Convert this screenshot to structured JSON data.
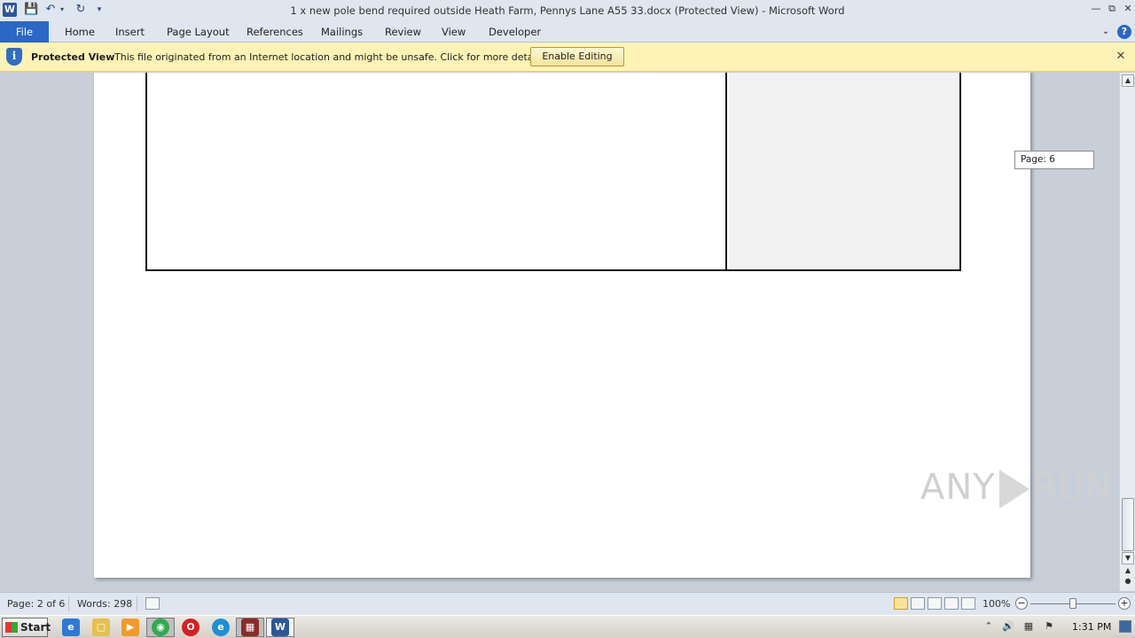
{
  "window": {
    "title": "1 x new pole bend required outside Heath Farm, Pennys Lane A55 33.docx (Protected View)  -  Microsoft Word",
    "app_icon_letter": "W"
  },
  "ribbon": {
    "tabs": [
      "File",
      "Home",
      "Insert",
      "Page Layout",
      "References",
      "Mailings",
      "Review",
      "View",
      "Developer"
    ],
    "help_label": "?"
  },
  "protected_view": {
    "title": "Protected View",
    "message": "This file originated from an Internet location and might be unsafe. Click for more details.",
    "button": "Enable Editing",
    "shield_glyph": "i"
  },
  "document": {
    "page_tooltip": "Page: 6"
  },
  "watermark": {
    "left": "ANY",
    "right": "RUN"
  },
  "status_bar": {
    "page": "Page: 2 of 6",
    "words": "Words: 298",
    "zoom": "100%",
    "zoom_level_percent": 100
  },
  "taskbar": {
    "start": "Start",
    "clock": "1:31 PM"
  },
  "colors": {
    "file_tab": "#2b67c6",
    "protected_bar": "#fdf3b5",
    "table_right_cell": "#f1f1f1"
  }
}
